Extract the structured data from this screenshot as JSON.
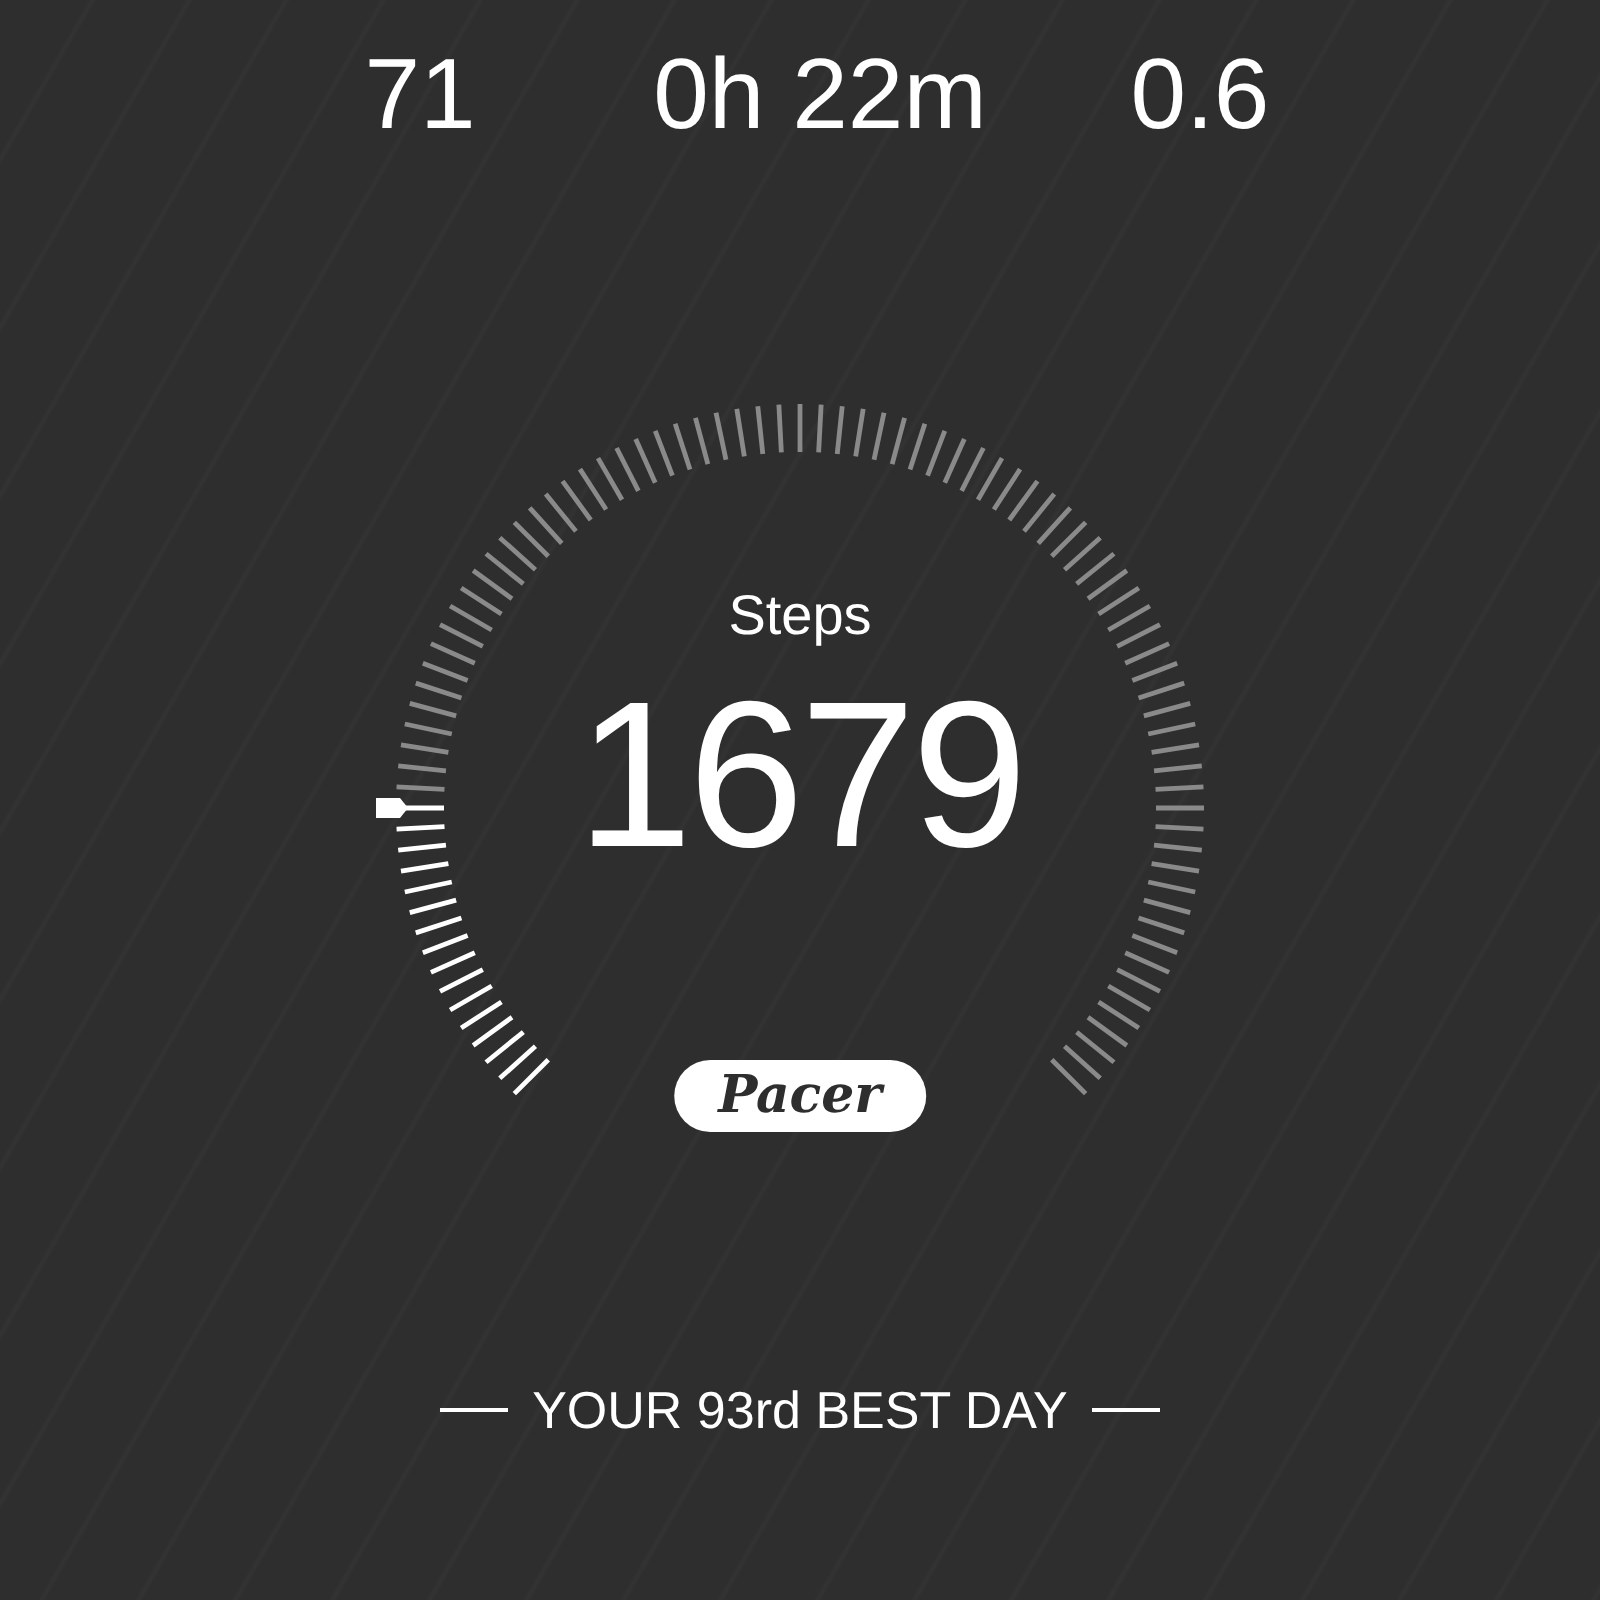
{
  "stats": [
    {
      "value": "71"
    },
    {
      "value": "0h 22m"
    },
    {
      "value": "0.6"
    }
  ],
  "steps": {
    "label": "Steps",
    "value": "1679"
  },
  "logo": {
    "text": "Pacer"
  },
  "footer": {
    "text": "YOUR 93rd BEST DAY"
  }
}
